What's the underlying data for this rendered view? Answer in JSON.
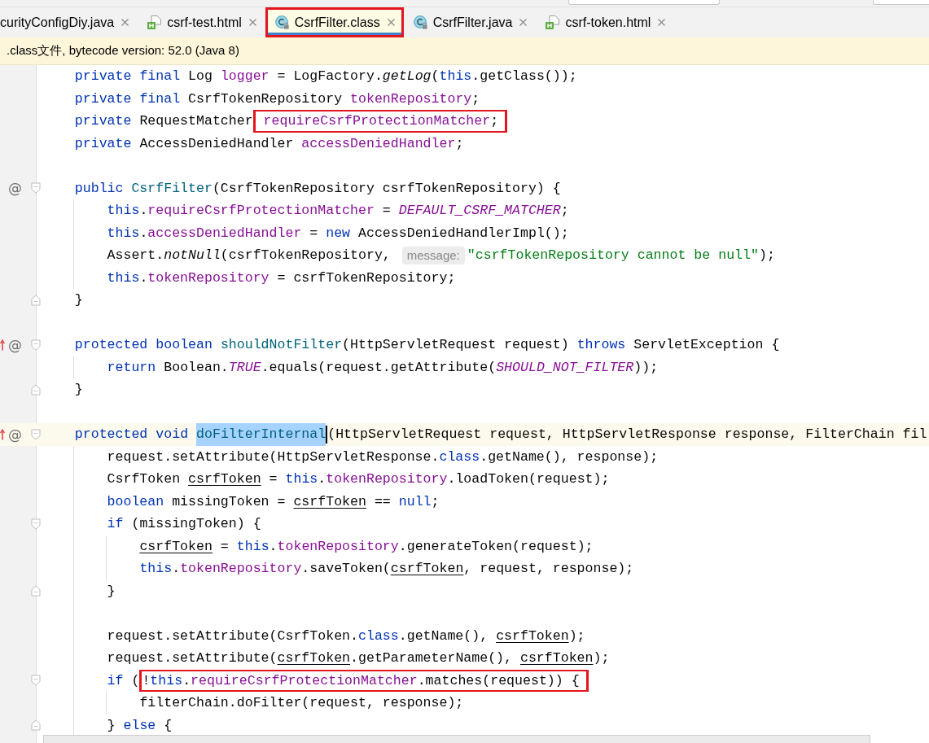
{
  "tabs": [
    {
      "label": "curityConfigDiy.java",
      "selected": false,
      "annotated": false
    },
    {
      "label": "csrf-test.html",
      "icon": {
        "kind": "html"
      },
      "selected": false,
      "annotated": false
    },
    {
      "label": "CsrfFilter.class",
      "icon": {
        "kind": "class"
      },
      "selected": true,
      "annotated": true
    },
    {
      "label": "CsrfFilter.java",
      "icon": {
        "kind": "class"
      },
      "selected": false,
      "annotated": false
    },
    {
      "label": "csrf-token.html",
      "icon": {
        "kind": "html"
      },
      "selected": false,
      "annotated": false
    }
  ],
  "banner": {
    "text": ".class文件, bytecode version: 52.0 (Java 8)"
  },
  "editor": {
    "lines": [
      {
        "kind": "code",
        "current": false,
        "tokens": [
          {
            "kind": "keyword",
            "text": "    private "
          },
          {
            "kind": "keyword",
            "text": "final "
          },
          {
            "kind": "plain",
            "text": "Log "
          },
          {
            "kind": "field",
            "text": "logger"
          },
          {
            "kind": "plain",
            "text": " = LogFactory."
          },
          {
            "kind": "static",
            "text": "getLog"
          },
          {
            "kind": "plain",
            "text": "("
          },
          {
            "kind": "keyword",
            "text": "this"
          },
          {
            "kind": "plain",
            "text": ".getClass());"
          }
        ]
      },
      {
        "kind": "code",
        "current": false,
        "tokens": [
          {
            "kind": "keyword",
            "text": "    private "
          },
          {
            "kind": "keyword",
            "text": "final "
          },
          {
            "kind": "plain",
            "text": "CsrfTokenRepository "
          },
          {
            "kind": "field",
            "text": "tokenRepository"
          },
          {
            "kind": "plain",
            "text": ";"
          }
        ]
      },
      {
        "kind": "code",
        "current": false,
        "tokens": [
          {
            "kind": "keyword",
            "text": "    private "
          },
          {
            "kind": "plain",
            "text": "RequestMatcher"
          },
          {
            "kind": "field",
            "text": " requireCsrfProtectionMatcher",
            "boxed": true
          },
          {
            "kind": "plain",
            "text": ";",
            "boxed": true
          }
        ]
      },
      {
        "kind": "code",
        "current": false,
        "tokens": [
          {
            "kind": "keyword",
            "text": "    private "
          },
          {
            "kind": "plain",
            "text": "AccessDeniedHandler "
          },
          {
            "kind": "field",
            "text": "accessDeniedHandler"
          },
          {
            "kind": "plain",
            "text": ";"
          }
        ]
      },
      {
        "kind": "blank",
        "current": false
      },
      {
        "kind": "code",
        "current": false,
        "gutter": {
          "marker": "@",
          "overrides": false
        },
        "fold_marker": {
          "kind": "start"
        },
        "tokens": [
          {
            "kind": "keyword",
            "text": "    public "
          },
          {
            "kind": "declaration",
            "text": "CsrfFilter"
          },
          {
            "kind": "plain",
            "text": "(CsrfTokenRepository csrfTokenRepository) {"
          }
        ]
      },
      {
        "kind": "code",
        "current": false,
        "tokens": [
          {
            "kind": "keyword",
            "text": "        this"
          },
          {
            "kind": "plain",
            "text": "."
          },
          {
            "kind": "field",
            "text": "requireCsrfProtectionMatcher"
          },
          {
            "kind": "plain",
            "text": " = "
          },
          {
            "kind": "constant",
            "text": "DEFAULT_CSRF_MATCHER"
          },
          {
            "kind": "plain",
            "text": ";"
          }
        ]
      },
      {
        "kind": "code",
        "current": false,
        "tokens": [
          {
            "kind": "keyword",
            "text": "        this"
          },
          {
            "kind": "plain",
            "text": "."
          },
          {
            "kind": "field",
            "text": "accessDeniedHandler"
          },
          {
            "kind": "plain",
            "text": " = "
          },
          {
            "kind": "keyword",
            "text": "new"
          },
          {
            "kind": "plain",
            "text": " AccessDeniedHandlerImpl();"
          }
        ]
      },
      {
        "kind": "code",
        "current": false,
        "tokens": [
          {
            "kind": "plain",
            "text": "        Assert."
          },
          {
            "kind": "static",
            "text": "notNull"
          },
          {
            "kind": "plain",
            "text": "(csrfTokenRepository, "
          },
          {
            "kind": "hint",
            "text": "message:"
          },
          {
            "kind": "string",
            "text": "\"csrfTokenRepository cannot be null\""
          },
          {
            "kind": "plain",
            "text": ");"
          }
        ]
      },
      {
        "kind": "code",
        "current": false,
        "tokens": [
          {
            "kind": "keyword",
            "text": "        this"
          },
          {
            "kind": "plain",
            "text": "."
          },
          {
            "kind": "field",
            "text": "tokenRepository"
          },
          {
            "kind": "plain",
            "text": " = csrfTokenRepository;"
          }
        ]
      },
      {
        "kind": "code",
        "current": false,
        "fold_marker": {
          "kind": "end"
        },
        "tokens": [
          {
            "kind": "plain",
            "text": "    }"
          }
        ]
      },
      {
        "kind": "blank",
        "current": false
      },
      {
        "kind": "code",
        "current": false,
        "gutter": {
          "marker": "@",
          "overrides": true
        },
        "fold_marker": {
          "kind": "start"
        },
        "tokens": [
          {
            "kind": "keyword",
            "text": "    protected "
          },
          {
            "kind": "keyword",
            "text": "boolean "
          },
          {
            "kind": "declaration",
            "text": "shouldNotFilter"
          },
          {
            "kind": "plain",
            "text": "(HttpServletRequest request) "
          },
          {
            "kind": "keyword",
            "text": "throws"
          },
          {
            "kind": "plain",
            "text": " ServletException {"
          }
        ]
      },
      {
        "kind": "code",
        "current": false,
        "tokens": [
          {
            "kind": "keyword",
            "text": "        return"
          },
          {
            "kind": "plain",
            "text": " Boolean."
          },
          {
            "kind": "constant",
            "text": "TRUE"
          },
          {
            "kind": "plain",
            "text": ".equals(request.getAttribute("
          },
          {
            "kind": "constant",
            "text": "SHOULD_NOT_FILTER"
          },
          {
            "kind": "plain",
            "text": "));"
          }
        ]
      },
      {
        "kind": "code",
        "current": false,
        "fold_marker": {
          "kind": "end"
        },
        "tokens": [
          {
            "kind": "plain",
            "text": "    }"
          }
        ]
      },
      {
        "kind": "blank",
        "current": false
      },
      {
        "kind": "code",
        "current": true,
        "gutter": {
          "marker": "@",
          "overrides": true
        },
        "fold_marker": {
          "kind": "start"
        },
        "tokens": [
          {
            "kind": "keyword",
            "text": "    protected "
          },
          {
            "kind": "keyword",
            "text": "void "
          },
          {
            "kind": "declaration",
            "text": "doFilterInternal",
            "selection": true,
            "caret": true
          },
          {
            "kind": "plain",
            "text": "(HttpServletRequest request, HttpServletResponse response, FilterChain fil"
          }
        ]
      },
      {
        "kind": "code",
        "current": false,
        "tokens": [
          {
            "kind": "plain",
            "text": "        request.setAttribute(HttpServletResponse."
          },
          {
            "kind": "keyword",
            "text": "class"
          },
          {
            "kind": "plain",
            "text": ".getName(), response);"
          }
        ]
      },
      {
        "kind": "code",
        "current": false,
        "tokens": [
          {
            "kind": "plain",
            "text": "        CsrfToken "
          },
          {
            "kind": "mutable",
            "text": "csrfToken"
          },
          {
            "kind": "plain",
            "text": " = "
          },
          {
            "kind": "keyword",
            "text": "this"
          },
          {
            "kind": "plain",
            "text": "."
          },
          {
            "kind": "field",
            "text": "tokenRepository"
          },
          {
            "kind": "plain",
            "text": ".loadToken(request);"
          }
        ]
      },
      {
        "kind": "code",
        "current": false,
        "tokens": [
          {
            "kind": "keyword",
            "text": "        boolean"
          },
          {
            "kind": "plain",
            "text": " missingToken = "
          },
          {
            "kind": "mutable",
            "text": "csrfToken"
          },
          {
            "kind": "plain",
            "text": " == "
          },
          {
            "kind": "keyword",
            "text": "null"
          },
          {
            "kind": "plain",
            "text": ";"
          }
        ]
      },
      {
        "kind": "code",
        "current": false,
        "fold_marker": {
          "kind": "start"
        },
        "tokens": [
          {
            "kind": "keyword",
            "text": "        if"
          },
          {
            "kind": "plain",
            "text": " (missingToken) {"
          }
        ]
      },
      {
        "kind": "code",
        "current": false,
        "tokens": [
          {
            "kind": "mutable",
            "text": "            csrfToken"
          },
          {
            "kind": "plain",
            "text": " = "
          },
          {
            "kind": "keyword",
            "text": "this"
          },
          {
            "kind": "plain",
            "text": "."
          },
          {
            "kind": "field",
            "text": "tokenRepository"
          },
          {
            "kind": "plain",
            "text": ".generateToken(request);"
          }
        ]
      },
      {
        "kind": "code",
        "current": false,
        "tokens": [
          {
            "kind": "keyword",
            "text": "            this"
          },
          {
            "kind": "plain",
            "text": "."
          },
          {
            "kind": "field",
            "text": "tokenRepository"
          },
          {
            "kind": "plain",
            "text": ".saveToken("
          },
          {
            "kind": "mutable",
            "text": "csrfToken"
          },
          {
            "kind": "plain",
            "text": ", request, response);"
          }
        ]
      },
      {
        "kind": "code",
        "current": false,
        "fold_marker": {
          "kind": "end"
        },
        "tokens": [
          {
            "kind": "plain",
            "text": "        }"
          }
        ]
      },
      {
        "kind": "blank",
        "current": false
      },
      {
        "kind": "code",
        "current": false,
        "tokens": [
          {
            "kind": "plain",
            "text": "        request.setAttribute(CsrfToken."
          },
          {
            "kind": "keyword",
            "text": "class"
          },
          {
            "kind": "plain",
            "text": ".getName(), "
          },
          {
            "kind": "mutable",
            "text": "csrfToken"
          },
          {
            "kind": "plain",
            "text": ");"
          }
        ]
      },
      {
        "kind": "code",
        "current": false,
        "tokens": [
          {
            "kind": "plain",
            "text": "        request.setAttribute("
          },
          {
            "kind": "mutable",
            "text": "csrfToken"
          },
          {
            "kind": "plain",
            "text": ".getParameterName(), "
          },
          {
            "kind": "mutable",
            "text": "csrfToken"
          },
          {
            "kind": "plain",
            "text": ");"
          }
        ]
      },
      {
        "kind": "code",
        "current": false,
        "fold_marker": {
          "kind": "start"
        },
        "tokens": [
          {
            "kind": "keyword",
            "text": "        if"
          },
          {
            "kind": "plain",
            "text": " ("
          },
          {
            "kind": "plain",
            "text": "!",
            "boxed": true
          },
          {
            "kind": "keyword",
            "text": "this",
            "boxed": true
          },
          {
            "kind": "plain",
            "text": ".",
            "boxed": true
          },
          {
            "kind": "field",
            "text": "requireCsrfProtectionMatcher",
            "boxed": true
          },
          {
            "kind": "plain",
            "text": ".matches(request)) {",
            "boxed": true
          }
        ]
      },
      {
        "kind": "code",
        "current": false,
        "tokens": [
          {
            "kind": "plain",
            "text": "            filterChain.doFilter(request, response);"
          }
        ]
      },
      {
        "kind": "code",
        "current": false,
        "fold_marker": {
          "kind": "end"
        },
        "tokens": [
          {
            "kind": "plain",
            "text": "        } "
          },
          {
            "kind": "keyword",
            "text": "else"
          },
          {
            "kind": "plain",
            "text": " {"
          }
        ]
      }
    ]
  }
}
